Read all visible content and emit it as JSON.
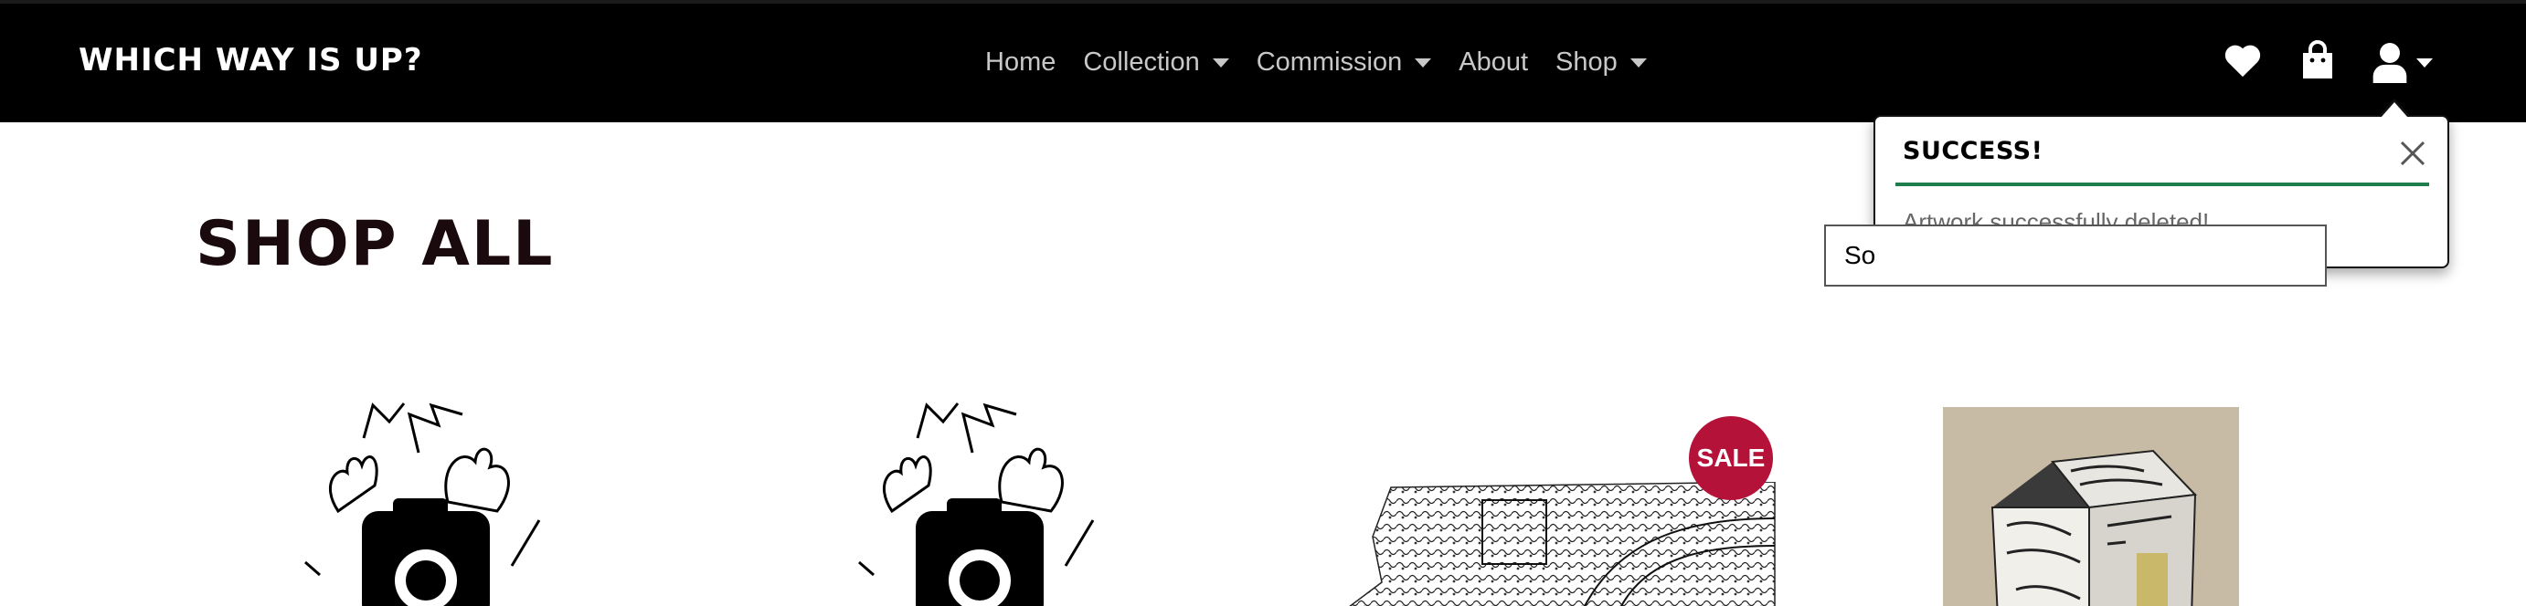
{
  "navbar": {
    "brand": "WHICH WAY IS UP?",
    "links": [
      {
        "label": "Home",
        "dropdown": false
      },
      {
        "label": "Collection",
        "dropdown": true
      },
      {
        "label": "Commission",
        "dropdown": true
      },
      {
        "label": "About",
        "dropdown": false
      },
      {
        "label": "Shop",
        "dropdown": true
      }
    ],
    "icons": [
      "heart-icon",
      "shopping-bag-icon",
      "user-icon"
    ]
  },
  "toast": {
    "title": "SUCCESS!",
    "message": "Artwork successfully deleted!",
    "accent": "#1e7e4e"
  },
  "page": {
    "title": "SHOP ALL",
    "sort_value": "So"
  },
  "products": [
    {
      "image": "no-image-placeholder-icon",
      "badge": ""
    },
    {
      "image": "no-image-placeholder-icon",
      "badge": ""
    },
    {
      "image": "patterned-artwork",
      "badge": "SALE"
    },
    {
      "image": "cube-artwork-photo",
      "badge": ""
    }
  ],
  "colors": {
    "navbar_bg": "#000000",
    "sale_badge": "#b5123a"
  }
}
